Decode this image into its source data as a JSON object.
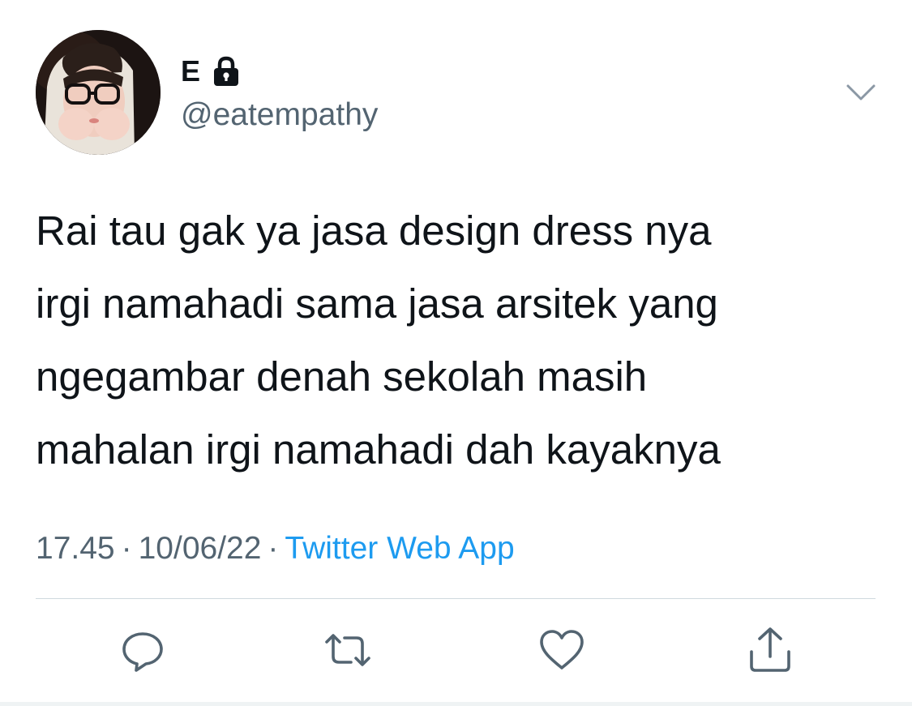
{
  "author": {
    "display_name": "E",
    "handle": "@eatempathy",
    "protected_icon": "lock-icon",
    "avatar": "profile-photo"
  },
  "tweet": {
    "text_lines": [
      "Rai tau gak ya jasa design dress nya",
      "irgi namahadi sama jasa arsitek yang",
      "ngegambar denah sekolah masih",
      "mahalan irgi namahadi dah kayaknya"
    ],
    "time": "17.45",
    "separator": "·",
    "date": "10/06/22",
    "source": "Twitter Web App"
  },
  "actions": {
    "reply_icon": "reply-icon",
    "retweet_icon": "retweet-icon",
    "like_icon": "heart-icon",
    "share_icon": "share-icon"
  },
  "colors": {
    "text": "#0f1419",
    "secondary": "#536471",
    "link": "#1d9bf0",
    "divider": "#cfd9de"
  }
}
